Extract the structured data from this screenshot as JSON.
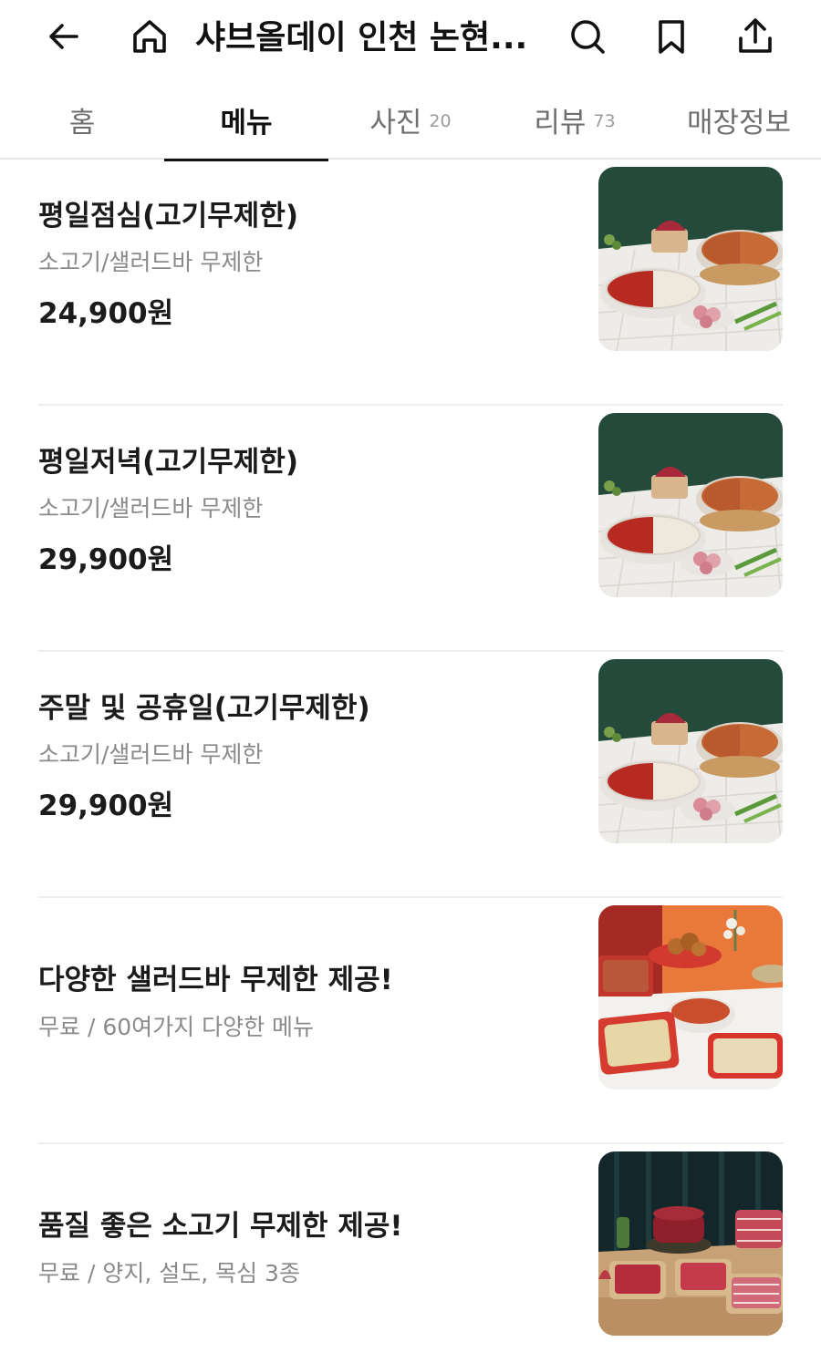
{
  "header": {
    "title": "샤브올데이 인천 논현...",
    "icons": [
      "back-arrow-icon",
      "home-icon",
      "search-icon",
      "bookmark-icon",
      "share-icon"
    ]
  },
  "tabs": [
    {
      "label": "홈",
      "count": ""
    },
    {
      "label": "메뉴",
      "count": ""
    },
    {
      "label": "사진",
      "count": "20"
    },
    {
      "label": "리뷰",
      "count": "73"
    },
    {
      "label": "매장정보",
      "count": ""
    }
  ],
  "active_tab": "메뉴",
  "menu": [
    {
      "name": "평일점심(고기무제한)",
      "desc": "소고기/샐러드바 무제한",
      "price": "24,900원",
      "image": "shabu-hotpot-photo"
    },
    {
      "name": "평일저녁(고기무제한)",
      "desc": "소고기/샐러드바 무제한",
      "price": "29,900원",
      "image": "shabu-hotpot-photo"
    },
    {
      "name": "주말 및 공휴일(고기무제한)",
      "desc": "소고기/샐러드바 무제한",
      "price": "29,900원",
      "image": "shabu-hotpot-photo"
    },
    {
      "name": "다양한 샐러드바 무제한 제공!",
      "desc": "무료 / 60여가지 다양한 메뉴",
      "price": "",
      "image": "salad-bar-photo"
    },
    {
      "name": "품질 좋은 소고기 무제한 제공!",
      "desc": "무료 / 양지, 설도, 목심 3종",
      "price": "",
      "image": "beef-platter-photo"
    }
  ],
  "colors": {
    "text": "#1b1b1b",
    "subtext": "#8a8a8a",
    "divider": "#eeeeee",
    "active_underline": "#111111"
  }
}
